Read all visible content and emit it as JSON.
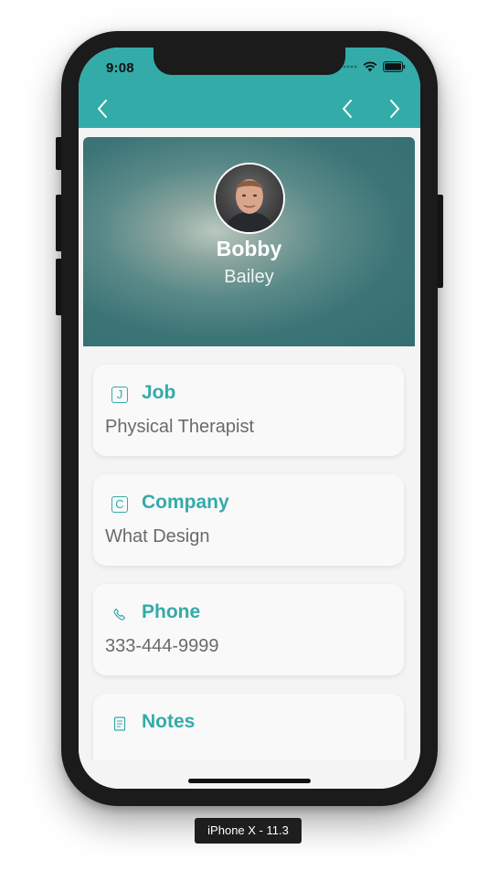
{
  "status_bar": {
    "time": "9:08"
  },
  "nav": {
    "back_icon": "chevron-left-icon",
    "prev_icon": "chevron-left-icon",
    "next_icon": "chevron-right-icon"
  },
  "contact": {
    "first_name": "Bobby",
    "last_name": "Bailey"
  },
  "cards": [
    {
      "icon_letter": "J",
      "title": "Job",
      "value": "Physical Therapist"
    },
    {
      "icon_letter": "C",
      "title": "Company",
      "value": "What Design"
    },
    {
      "icon": "phone-icon",
      "title": "Phone",
      "value": "333-444-9999"
    },
    {
      "icon": "notes-icon",
      "title": "Notes",
      "value": ""
    }
  ],
  "device_label": "iPhone X - 11.3",
  "colors": {
    "accent": "#33aba9",
    "frame": "#1b1b1b",
    "background": "#f4f4f4"
  }
}
